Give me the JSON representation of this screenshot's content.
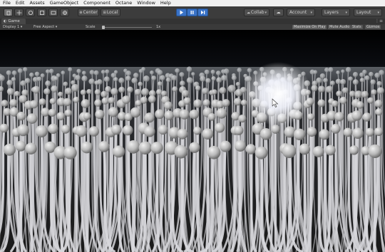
{
  "menu": [
    "File",
    "Edit",
    "Assets",
    "GameObject",
    "Component",
    "Octane",
    "Window",
    "Help"
  ],
  "toolbar": {
    "tools": [
      "hand-icon",
      "move-icon",
      "rotate-icon",
      "scale-icon",
      "rect-icon",
      "transform-icon"
    ],
    "pivot_mode": "Center",
    "pivot_space": "Local",
    "play_controls": [
      "play-icon",
      "pause-icon",
      "step-icon"
    ],
    "collab_label": "Collab",
    "account_label": "Account",
    "layers_label": "Layers",
    "layout_label": "Layout"
  },
  "game_tab": {
    "title": "Game"
  },
  "game_bar": {
    "display": "Display 1",
    "aspect": "Free Aspect",
    "scale_label": "Scale",
    "scale_value": "1x",
    "maximize_on_play": "Maximize On Play",
    "mute_audio": "Mute Audio",
    "stats": "Stats",
    "gizmos": "Gizmos"
  },
  "colors": {
    "toolbar_bg": "#3c3c3c",
    "play_active": "#3a73c7",
    "scene_background": "#0a0a0a",
    "glow": "#ffffff"
  },
  "scene": {
    "description_icon": "cursor-icon"
  }
}
